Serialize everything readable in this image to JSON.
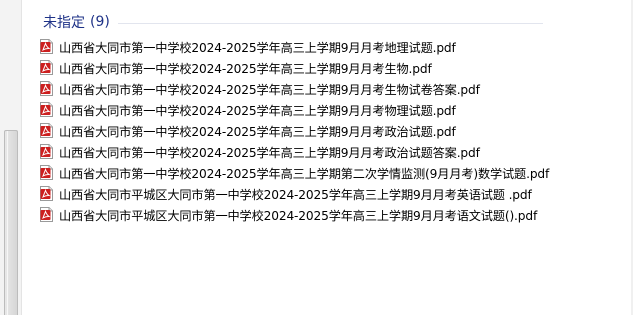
{
  "group": {
    "title": "未指定",
    "count": "(9)"
  },
  "files": [
    {
      "name": "山西省大同市第一中学校2024-2025学年高三上学期9月月考地理试题.pdf",
      "icon": "pdf-icon"
    },
    {
      "name": "山西省大同市第一中学校2024-2025学年高三上学期9月月考生物.pdf",
      "icon": "pdf-icon"
    },
    {
      "name": "山西省大同市第一中学校2024-2025学年高三上学期9月月考生物试卷答案.pdf",
      "icon": "pdf-icon"
    },
    {
      "name": "山西省大同市第一中学校2024-2025学年高三上学期9月月考物理试题.pdf",
      "icon": "pdf-icon"
    },
    {
      "name": "山西省大同市第一中学校2024-2025学年高三上学期9月月考政治试题.pdf",
      "icon": "pdf-icon"
    },
    {
      "name": "山西省大同市第一中学校2024-2025学年高三上学期9月月考政治试题答案.pdf",
      "icon": "pdf-icon"
    },
    {
      "name": "山西省大同市第一中学校2024-2025学年高三上学期第二次学情监测(9月月考)数学试题.pdf",
      "icon": "pdf-icon"
    },
    {
      "name": "山西省大同市平城区大同市第一中学校2024-2025学年高三上学期9月月考英语试题 .pdf",
      "icon": "pdf-icon"
    },
    {
      "name": "山西省大同市平城区大同市第一中学校2024-2025学年高三上学期9月月考语文试题().pdf",
      "icon": "pdf-icon"
    }
  ],
  "colors": {
    "group_header": "#1e3287",
    "pdf_icon": "#cc1f1f"
  }
}
